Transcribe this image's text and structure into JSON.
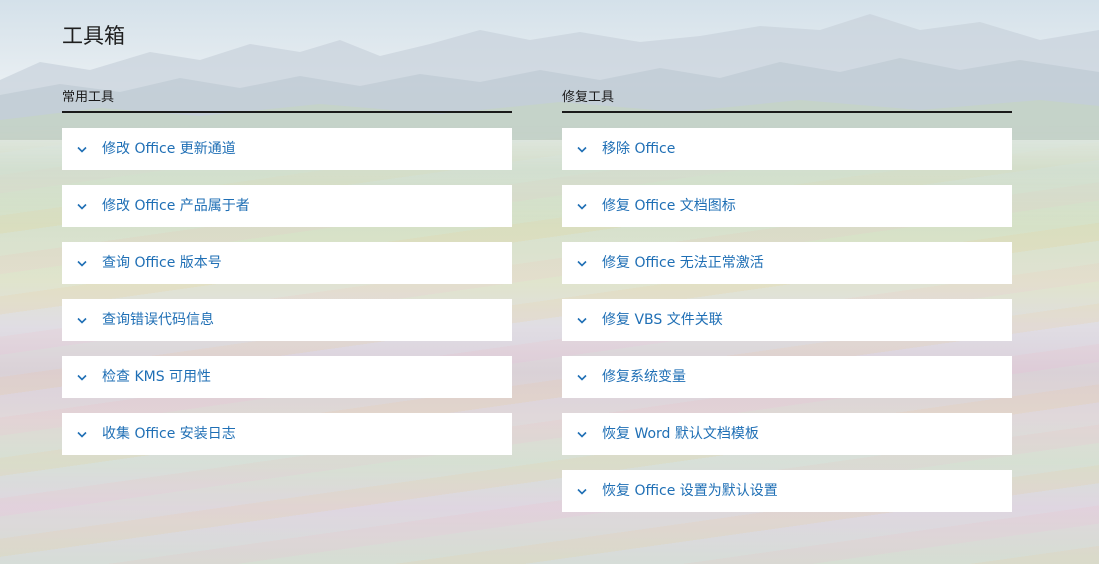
{
  "page": {
    "title": "工具箱"
  },
  "colors": {
    "link": "#1f6fb5",
    "heading": "#1a1a1a",
    "card": "#ffffff"
  },
  "sections": [
    {
      "header": "常用工具",
      "items": [
        {
          "label": "修改 Office 更新通道",
          "icon": "chevron-down-icon"
        },
        {
          "label": "修改 Office 产品属于者",
          "icon": "chevron-down-icon"
        },
        {
          "label": "查询 Office 版本号",
          "icon": "chevron-down-icon"
        },
        {
          "label": "查询错误代码信息",
          "icon": "chevron-down-icon"
        },
        {
          "label": "检查 KMS 可用性",
          "icon": "chevron-down-icon"
        },
        {
          "label": "收集 Office 安装日志",
          "icon": "chevron-down-icon"
        }
      ]
    },
    {
      "header": "修复工具",
      "items": [
        {
          "label": "移除 Office",
          "icon": "chevron-down-icon"
        },
        {
          "label": "修复 Office 文档图标",
          "icon": "chevron-down-icon"
        },
        {
          "label": "修复 Office 无法正常激活",
          "icon": "chevron-down-icon"
        },
        {
          "label": "修复 VBS 文件关联",
          "icon": "chevron-down-icon"
        },
        {
          "label": "修复系统变量",
          "icon": "chevron-down-icon"
        },
        {
          "label": "恢复 Word 默认文档模板",
          "icon": "chevron-down-icon"
        },
        {
          "label": "恢复 Office 设置为默认设置",
          "icon": "chevron-down-icon"
        }
      ]
    }
  ]
}
